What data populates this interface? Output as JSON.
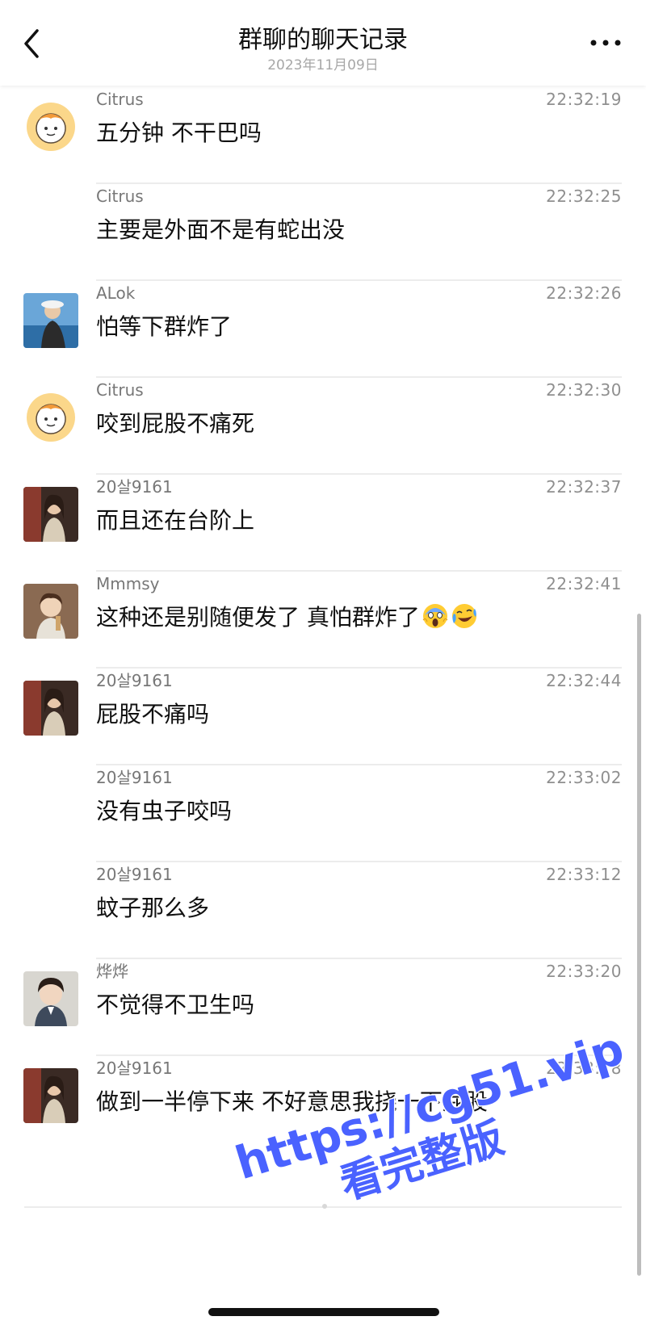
{
  "header": {
    "title": "群聊的聊天记录",
    "subtitle": "2023年11月09日"
  },
  "messages": [
    {
      "sender": "Citrus",
      "time": "22:32:19",
      "text": "五分钟 不干巴吗",
      "avatar": "citrus-avatar"
    },
    {
      "sender": "Citrus",
      "time": "22:32:25",
      "text": "主要是外面不是有蛇出没",
      "avatar": ""
    },
    {
      "sender": "ALok",
      "time": "22:32:26",
      "text": "怕等下群炸了",
      "avatar": "alok-avatar"
    },
    {
      "sender": "Citrus",
      "time": "22:32:30",
      "text": "咬到屁股不痛死",
      "avatar": "citrus-avatar"
    },
    {
      "sender": "20살9161",
      "time": "22:32:37",
      "text": "而且还在台阶上",
      "avatar": "girl-avatar"
    },
    {
      "sender": "Mmmsy",
      "time": "22:32:41",
      "text": "这种还是别随便发了 真怕群炸了",
      "emojis": [
        "scream-emoji",
        "laughing-tears-emoji"
      ],
      "avatar": "mmmsy-avatar"
    },
    {
      "sender": "20살9161",
      "time": "22:32:44",
      "text": "屁股不痛吗",
      "avatar": "girl-avatar"
    },
    {
      "sender": "20살9161",
      "time": "22:33:02",
      "text": "没有虫子咬吗",
      "avatar": ""
    },
    {
      "sender": "20살9161",
      "time": "22:33:12",
      "text": "蚊子那么多",
      "avatar": ""
    },
    {
      "sender": "烨烨",
      "time": "22:33:20",
      "text": "不觉得不卫生吗",
      "avatar": "yeye-avatar"
    },
    {
      "sender": "20살9161",
      "time": "22:33:28",
      "text": "做到一半停下来 不好意思我挠一下屁股",
      "avatar": "girl-avatar"
    }
  ],
  "watermark": {
    "url": "https://cg51.vip",
    "text": "看完整版"
  },
  "colors": {
    "watermark": "#4a62ff",
    "separator": "#ececec",
    "meta_text": "#8f8f8f"
  }
}
